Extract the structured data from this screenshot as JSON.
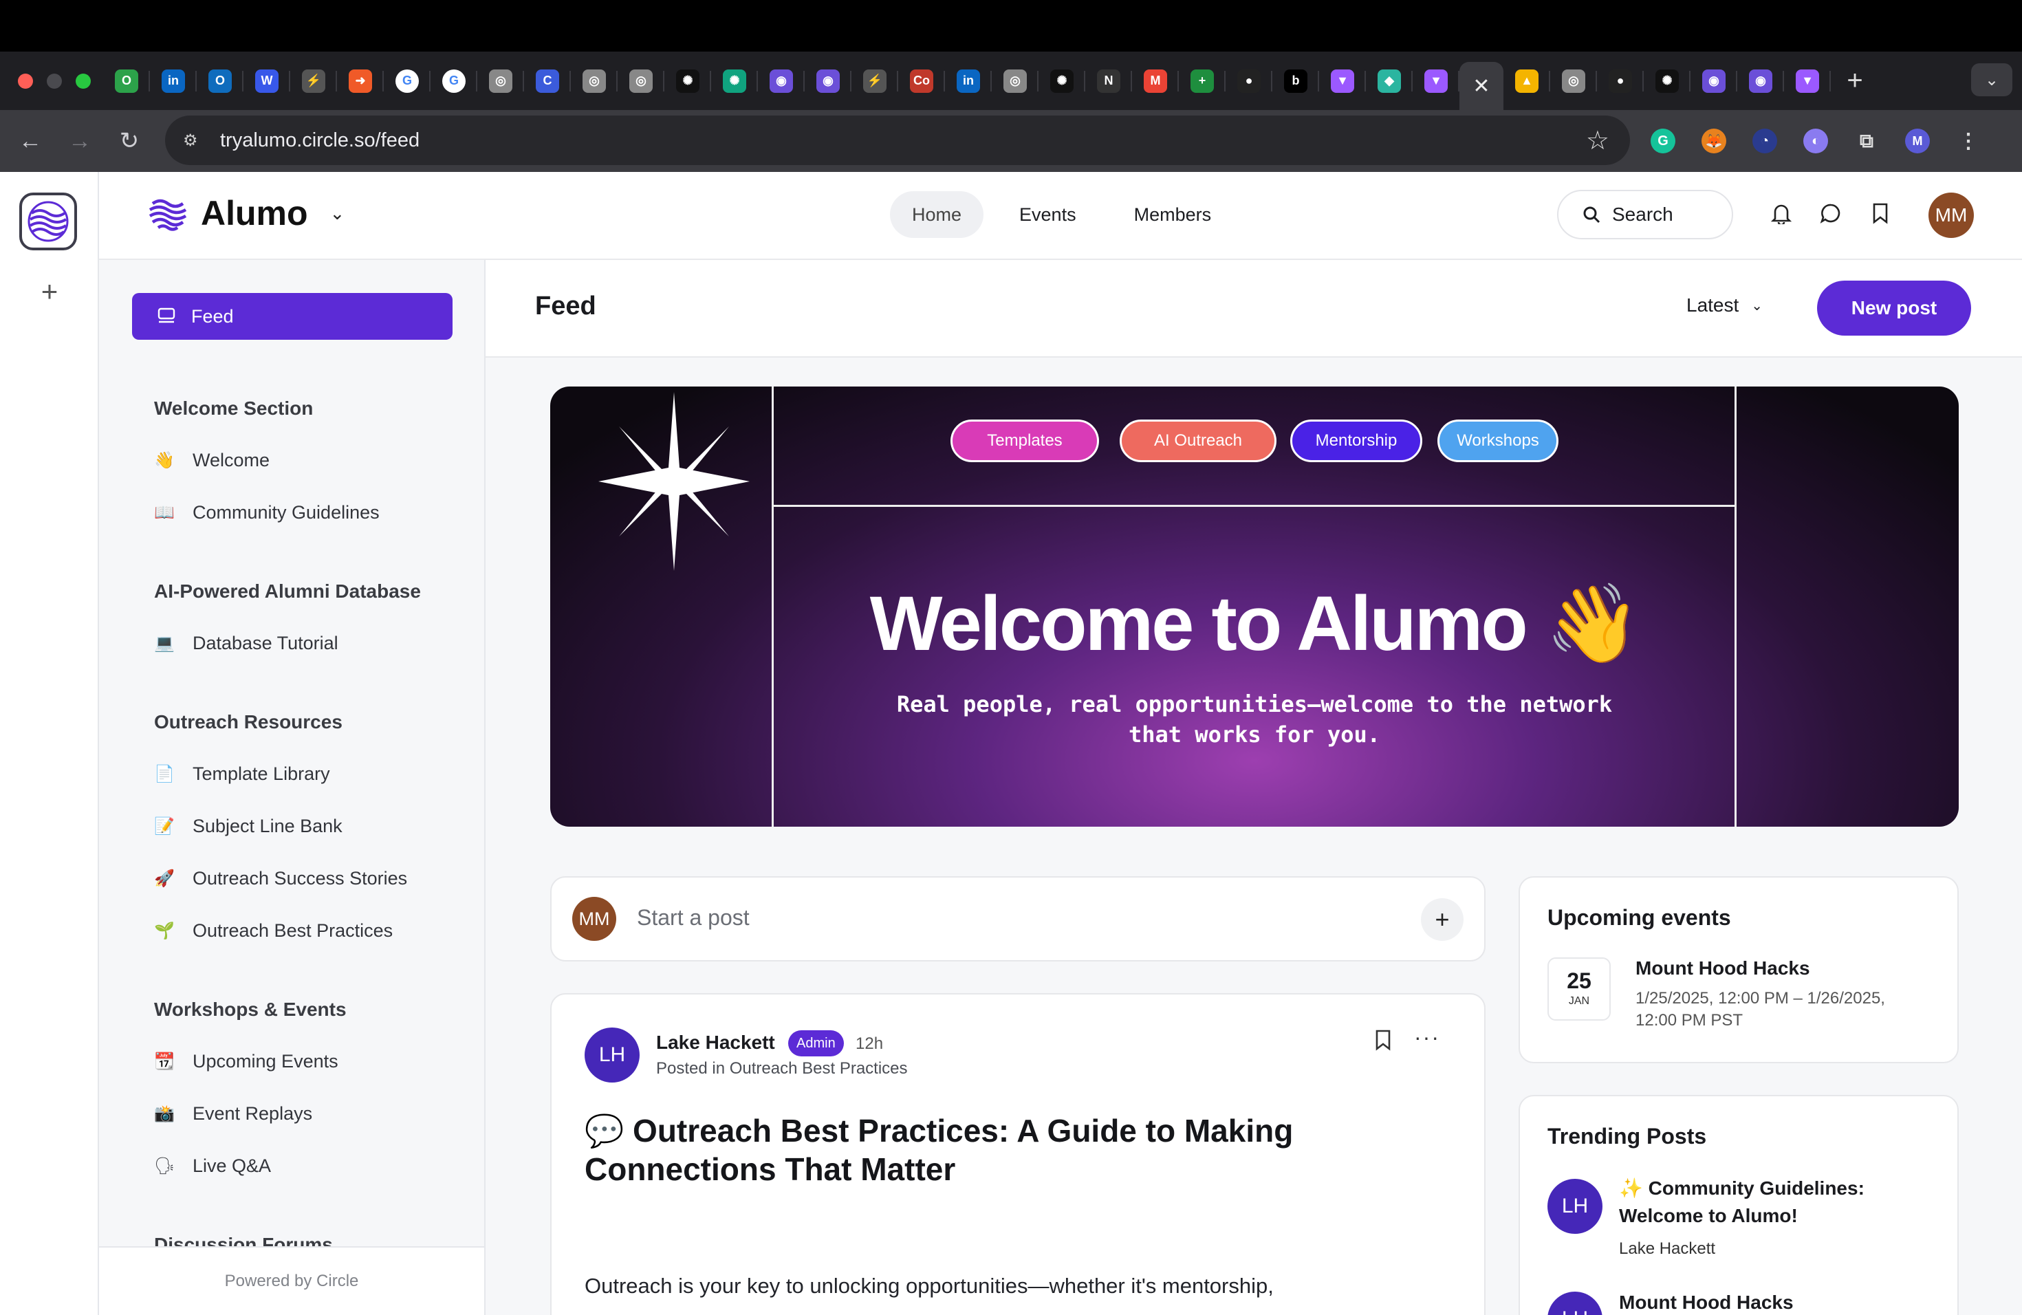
{
  "browser": {
    "url": "tryalumo.circle.so/feed",
    "tabs": [
      {
        "icon": "opal-icon",
        "color": "#2ca24a",
        "glyph": "O"
      },
      {
        "icon": "linkedin-icon",
        "color": "#0a66c2",
        "glyph": "in"
      },
      {
        "icon": "outlook-icon",
        "color": "#0f6cbd",
        "glyph": "O"
      },
      {
        "icon": "wordpress-icon",
        "color": "#3858e9",
        "glyph": "W"
      },
      {
        "icon": "bolt-icon",
        "color": "#555",
        "glyph": "⚡"
      },
      {
        "icon": "arrow-icon",
        "color": "#f05a28",
        "glyph": "➜"
      },
      {
        "icon": "google-icon",
        "color": "#fff",
        "glyph": "G"
      },
      {
        "icon": "google-icon",
        "color": "#fff",
        "glyph": "G"
      },
      {
        "icon": "chrome-icon",
        "color": "#888",
        "glyph": "◎"
      },
      {
        "icon": "c-icon",
        "color": "#3b5bdb",
        "glyph": "C"
      },
      {
        "icon": "chrome-icon",
        "color": "#888",
        "glyph": "◎"
      },
      {
        "icon": "chrome-icon",
        "color": "#888",
        "glyph": "◎"
      },
      {
        "icon": "openai-icon",
        "color": "#111",
        "glyph": "✺"
      },
      {
        "icon": "openai-icon",
        "color": "#10a37f",
        "glyph": "✺"
      },
      {
        "icon": "alumo-icon",
        "color": "#6b4fd8",
        "glyph": "◉"
      },
      {
        "icon": "alumo-icon",
        "color": "#6b4fd8",
        "glyph": "◉"
      },
      {
        "icon": "bolt-icon",
        "color": "#555",
        "glyph": "⚡"
      },
      {
        "icon": "coursera-icon",
        "color": "#c0392b",
        "glyph": "Co"
      },
      {
        "icon": "linkedin-icon",
        "color": "#0a66c2",
        "glyph": "in"
      },
      {
        "icon": "chrome-icon",
        "color": "#888",
        "glyph": "◎"
      },
      {
        "icon": "openai-icon",
        "color": "#111",
        "glyph": "✺"
      },
      {
        "icon": "notion-icon",
        "color": "#333",
        "glyph": "N"
      },
      {
        "icon": "gmail-icon",
        "color": "#ea4335",
        "glyph": "M"
      },
      {
        "icon": "sheets-plus-icon",
        "color": "#1e8e3e",
        "glyph": "+"
      },
      {
        "icon": "github-icon",
        "color": "#222",
        "glyph": "●"
      },
      {
        "icon": "b-icon",
        "color": "#000",
        "glyph": "b"
      },
      {
        "icon": "vite-icon",
        "color": "#9b59ff",
        "glyph": "▼"
      },
      {
        "icon": "diamond-icon",
        "color": "#2bb5a0",
        "glyph": "◆"
      },
      {
        "icon": "vite-icon",
        "color": "#9b59ff",
        "glyph": "▼"
      }
    ],
    "active_tab_glyph": "✕",
    "tabs_after": [
      {
        "icon": "airtable-icon",
        "color": "#f4b400",
        "glyph": "▲"
      },
      {
        "icon": "chrome-icon",
        "color": "#888",
        "glyph": "◎"
      },
      {
        "icon": "github-icon",
        "color": "#222",
        "glyph": "●"
      },
      {
        "icon": "openai-icon",
        "color": "#111",
        "glyph": "✺"
      },
      {
        "icon": "alumo-icon",
        "color": "#6b4fd8",
        "glyph": "◉"
      },
      {
        "icon": "alumo-icon",
        "color": "#6b4fd8",
        "glyph": "◉"
      },
      {
        "icon": "vite-icon",
        "color": "#9b59ff",
        "glyph": "▼"
      }
    ],
    "new_tab": "+",
    "profile_initial": "M"
  },
  "app": {
    "brand": "Alumo",
    "nav": [
      "Home",
      "Events",
      "Members"
    ],
    "search_label": "Search",
    "user_initials": "MM"
  },
  "sidebar": {
    "feed_label": "Feed",
    "sections": [
      {
        "title": "Welcome Section",
        "items": [
          {
            "emoji": "👋",
            "label": "Welcome"
          },
          {
            "emoji": "📖",
            "label": "Community Guidelines"
          }
        ]
      },
      {
        "title": "AI-Powered Alumni Database",
        "items": [
          {
            "emoji": "💻",
            "label": "Database Tutorial"
          }
        ]
      },
      {
        "title": "Outreach Resources",
        "items": [
          {
            "emoji": "📄",
            "label": "Template Library"
          },
          {
            "emoji": "📝",
            "label": "Subject Line Bank"
          },
          {
            "emoji": "🚀",
            "label": "Outreach Success Stories"
          },
          {
            "emoji": "🌱",
            "label": "Outreach Best Practices"
          }
        ]
      },
      {
        "title": "Workshops & Events",
        "items": [
          {
            "emoji": "📆",
            "label": "Upcoming Events"
          },
          {
            "emoji": "📸",
            "label": "Event Replays"
          },
          {
            "emoji": "🗣",
            "label": "Live Q&A"
          }
        ]
      },
      {
        "title": "Discussion Forums",
        "items": []
      }
    ],
    "powered_by": "Powered by Circle"
  },
  "main": {
    "title": "Feed",
    "sort": "Latest",
    "new_post": "New post",
    "banner": {
      "pills": [
        {
          "label": "Templates",
          "color": "#d93bb7"
        },
        {
          "label": "AI Outreach",
          "color": "#ee6a5f"
        },
        {
          "label": "Mentorship",
          "color": "#4a22e6"
        },
        {
          "label": "Workshops",
          "color": "#4fa3ef"
        }
      ],
      "title": "Welcome to Alumo 👋",
      "subtitle_line1": "Real people, real opportunities—welcome to the network",
      "subtitle_line2": "that works for you."
    },
    "composer": {
      "avatar": "MM",
      "placeholder": "Start a post"
    },
    "post": {
      "avatar": "LH",
      "author": "Lake Hackett",
      "badge": "Admin",
      "time": "12h",
      "posted_in": "Posted in Outreach Best Practices",
      "title": "💬 Outreach Best Practices: A Guide to Making Connections That Matter",
      "body": "Outreach is your key to unlocking opportunities—whether it's mentorship,"
    }
  },
  "right": {
    "events_title": "Upcoming events",
    "event": {
      "day": "25",
      "month": "JAN",
      "name": "Mount Hood Hacks",
      "time": "1/25/2025, 12:00 PM – 1/26/2025, 12:00 PM PST"
    },
    "trending_title": "Trending Posts",
    "trending": [
      {
        "avatar": "LH",
        "title": "✨ Community Guidelines: Welcome to Alumo!",
        "author": "Lake Hackett"
      },
      {
        "avatar": "LH",
        "title": "Mount Hood Hacks",
        "author": ""
      }
    ]
  }
}
